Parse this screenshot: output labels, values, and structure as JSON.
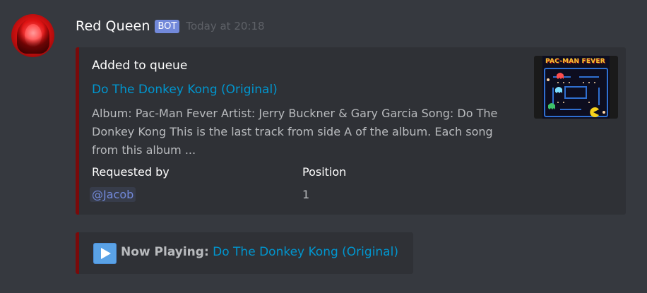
{
  "message": {
    "username": "Red Queen",
    "bot_tag": "BOT",
    "timestamp": "Today at 20:18",
    "avatar_icon": "red-queen-avatar"
  },
  "embed_queue": {
    "accent_color": "#7a0a0a",
    "title": "Added to queue",
    "link_text": "Do The Donkey Kong (Original)",
    "description": "Album: Pac-Man Fever Artist: Jerry Buckner & Gary Garcia Song: Do The Donkey Kong This is the last track from side A of the album. Each song from this album ...",
    "fields": [
      {
        "name": "Requested by",
        "value": "@Jacob"
      },
      {
        "name": "Position",
        "value": "1"
      }
    ],
    "thumbnail": {
      "alt_icon": "pac-man-fever-album-art",
      "title_text": "PAC-MAN FEVER"
    }
  },
  "embed_now_playing": {
    "accent_color": "#7a0a0a",
    "icon": "play-icon",
    "label": "Now Playing:",
    "link_text": "Do The Donkey Kong (Original)"
  },
  "colors": {
    "background": "#36393f",
    "embed_background": "#2f3136",
    "link": "#0096cf",
    "bot_tag": "#7289da",
    "mention": "#7289da"
  }
}
